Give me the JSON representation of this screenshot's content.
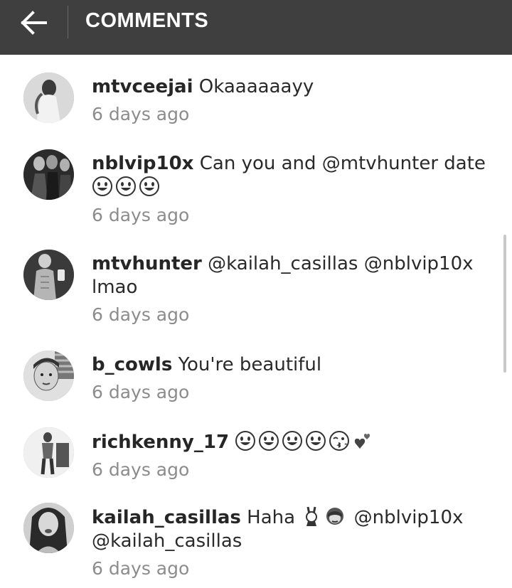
{
  "header": {
    "title": "COMMENTS"
  },
  "comments": [
    {
      "username": "mtvceejai",
      "text": "Okaaaaaayy",
      "time": "6 days ago"
    },
    {
      "username": "nblvip10x",
      "text": "Can you and @mtvhunter date",
      "emojis": [
        "grinning-face",
        "grinning-face",
        "grinning-face"
      ],
      "time": "6 days ago"
    },
    {
      "username": "mtvhunter",
      "text": "@kailah_casillas @nblvip10x",
      "text2": "lmao",
      "time": "6 days ago"
    },
    {
      "username": "b_cowls",
      "text": "You're beautiful",
      "time": "6 days ago"
    },
    {
      "username": "richkenny_17",
      "emojis": [
        "grinning-face",
        "grinning-face",
        "grinning-face",
        "grinning-face",
        "kissing-face",
        "two-hearts"
      ],
      "time": "6 days ago"
    },
    {
      "username": "kailah_casillas",
      "text": "Haha",
      "emojis": [
        "bunny-dancers",
        "see-no-evil-monkey"
      ],
      "mention1": "@nblvip10x",
      "mention2": "@kailah_casillas",
      "time": "6 days ago"
    }
  ]
}
